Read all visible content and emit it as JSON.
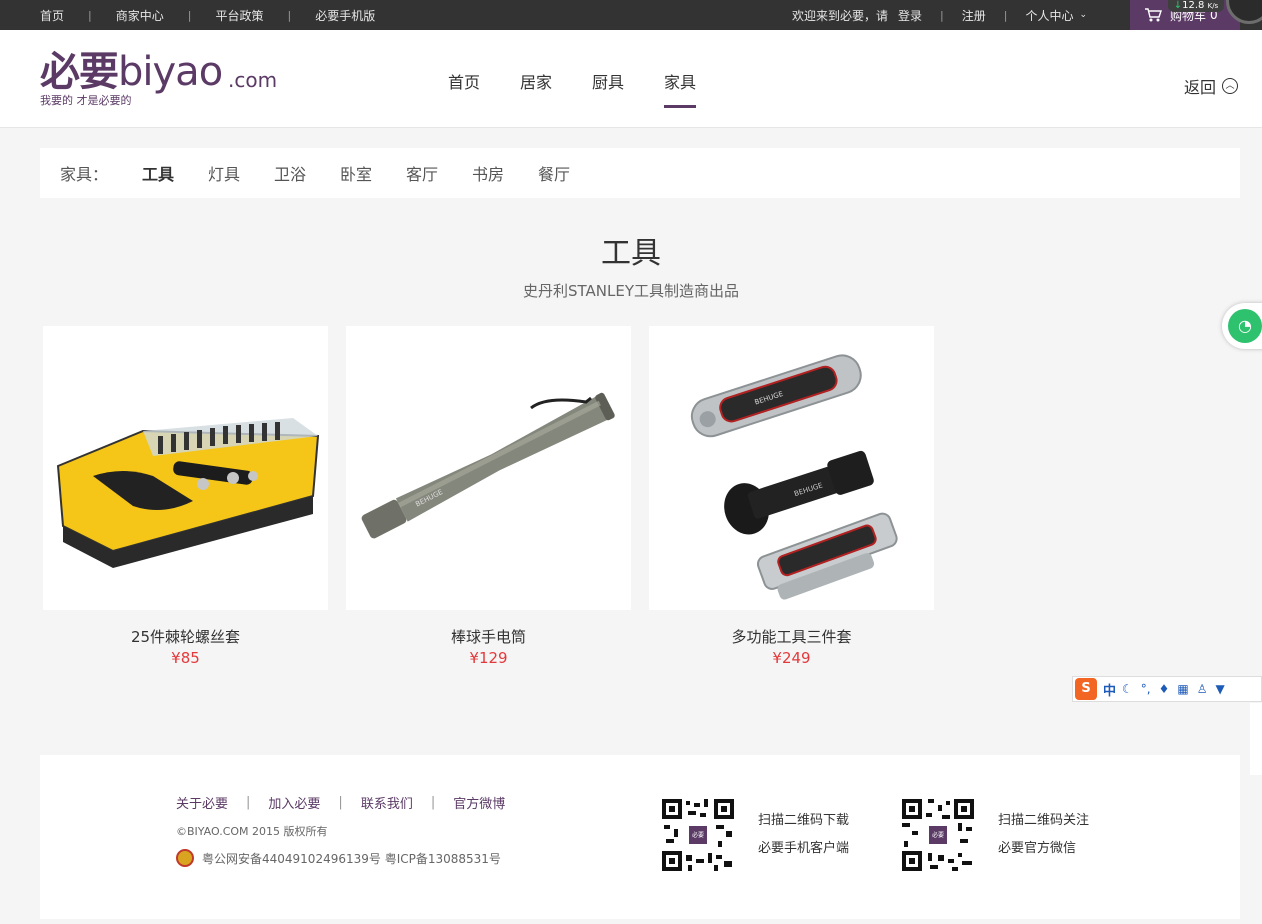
{
  "topbar": {
    "links": [
      "首页",
      "商家中心",
      "平台政策",
      "必要手机版"
    ],
    "welcome": "欢迎来到必要，请",
    "login": "登录",
    "register": "注册",
    "user_center": "个人中心",
    "cart_label": "购物车",
    "cart_count": "0",
    "speed": "12.8",
    "speed_unit": "K/s"
  },
  "header": {
    "logo_cn": "必要",
    "logo_en": "biyao",
    "logo_dotcom": ".com",
    "slogan": "我要的 才是必要的",
    "nav": [
      "首页",
      "居家",
      "厨具",
      "家具"
    ],
    "active_nav": "家具",
    "back": "返回"
  },
  "categories": {
    "label": "家具：",
    "items": [
      "工具",
      "灯具",
      "卫浴",
      "卧室",
      "客厅",
      "书房",
      "餐厅"
    ],
    "active": "工具"
  },
  "section": {
    "title": "工具",
    "subtitle": "史丹利STANLEY工具制造商出品"
  },
  "products": [
    {
      "name": "25件棘轮螺丝套",
      "price": "¥85"
    },
    {
      "name": "棒球手电筒",
      "price": "¥129"
    },
    {
      "name": "多功能工具三件套",
      "price": "¥249"
    }
  ],
  "product_brand_mark": "BEHUGE",
  "footer": {
    "links": [
      "关于必要",
      "加入必要",
      "联系我们",
      "官方微博"
    ],
    "copyright": "©BIYAO.COM 2015 版权所有",
    "icp": "粤公网安备44049102496139号 粤ICP备13088531号",
    "qr_center_label": "必要",
    "qr1_line1": "扫描二维码下载",
    "qr1_line2": "必要手机客户端",
    "qr2_line1": "扫描二维码关注",
    "qr2_line2": "必要官方微信"
  },
  "ime": {
    "logo": "S",
    "mode": "中"
  },
  "colors": {
    "brand": "#5b3a66",
    "price": "#e4393c",
    "wifi": "#2ec26f"
  }
}
